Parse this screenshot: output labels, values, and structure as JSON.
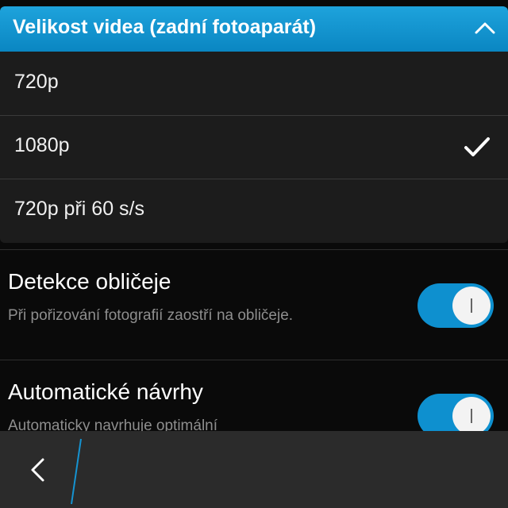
{
  "dropdown": {
    "title": "Velikost videa (zadní fotoaparát)",
    "header_color": "#1593d1",
    "options": [
      {
        "label": "720p",
        "selected": false
      },
      {
        "label": "1080p",
        "selected": true
      },
      {
        "label": "720p při 60 s/s",
        "selected": false
      }
    ]
  },
  "settings": [
    {
      "title": "Detekce obličeje",
      "description": "Při pořizování fotografií zaostří na obličeje.",
      "enabled": true
    },
    {
      "title": "Automatické návrhy",
      "description": "Automaticky navrhuje optimální",
      "enabled": true
    }
  ],
  "icons": {
    "collapse": "chevron-up-icon",
    "selected": "checkmark-icon",
    "back": "back-arrow-icon"
  },
  "accent_color": "#0e90cf"
}
